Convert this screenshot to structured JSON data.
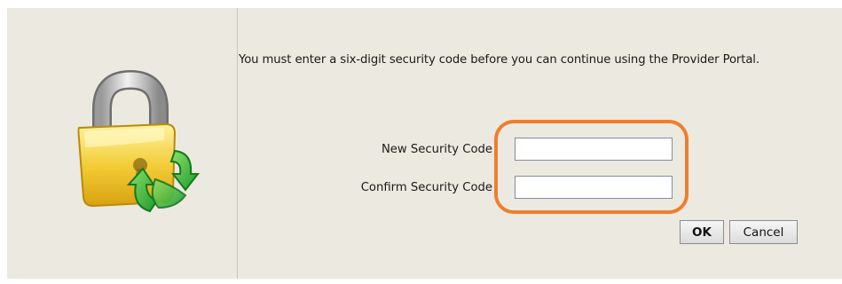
{
  "dialog": {
    "message": "You must enter a six-digit security code before you can continue using the Provider Portal.",
    "icon": "lock-refresh-icon",
    "fields": {
      "new_label": "New Security Code",
      "new_value": "",
      "confirm_label": "Confirm Security Code",
      "confirm_value": ""
    },
    "buttons": {
      "ok": "OK",
      "cancel": "Cancel"
    },
    "highlight_color": "#ee7e2f"
  }
}
